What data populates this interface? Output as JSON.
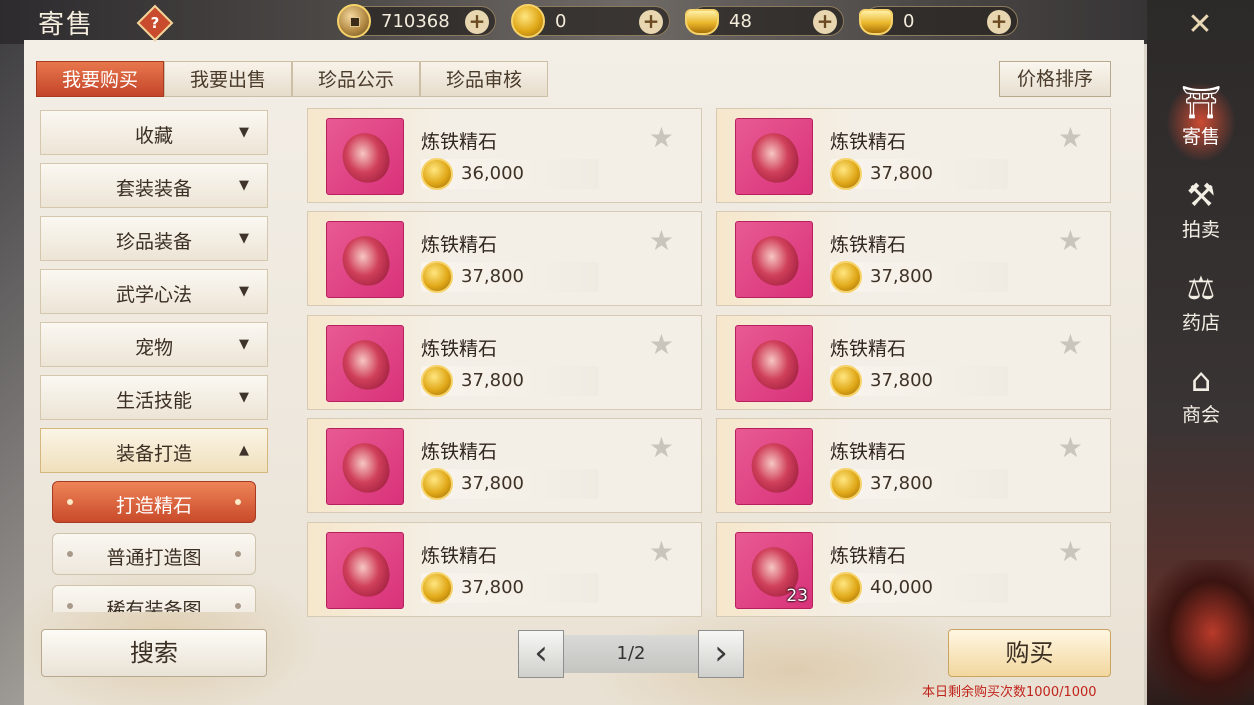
{
  "header": {
    "title": "寄售",
    "help_icon": "question-mark-icon",
    "currencies": [
      {
        "icon": "copper-coin-icon",
        "value": "710368"
      },
      {
        "icon": "gold-coin-icon",
        "value": "0"
      },
      {
        "icon": "bound-ingot-icon",
        "value": "48"
      },
      {
        "icon": "gold-ingot-icon",
        "value": "0"
      }
    ],
    "plus_symbol": "+",
    "close_symbol": "✕"
  },
  "tabs": [
    {
      "label": "我要购买",
      "active": true
    },
    {
      "label": "我要出售",
      "active": false
    },
    {
      "label": "珍品公示",
      "active": false
    },
    {
      "label": "珍品审核",
      "active": false
    }
  ],
  "sort_button": "价格排序",
  "categories": [
    {
      "label": "收藏",
      "arrow": "▼"
    },
    {
      "label": "套装装备",
      "arrow": "▼"
    },
    {
      "label": "珍品装备",
      "arrow": "▼"
    },
    {
      "label": "武学心法",
      "arrow": "▼"
    },
    {
      "label": "宠物",
      "arrow": "▼"
    },
    {
      "label": "生活技能",
      "arrow": "▼"
    },
    {
      "label": "装备打造",
      "arrow": "▲"
    }
  ],
  "subcategories": [
    {
      "label": "打造精石",
      "active": true
    },
    {
      "label": "普通打造图",
      "active": false
    },
    {
      "label": "稀有装备图",
      "active": false
    }
  ],
  "search_button": "搜索",
  "items": [
    {
      "name": "炼铁精石",
      "price": "36,000",
      "qty": ""
    },
    {
      "name": "炼铁精石",
      "price": "37,800",
      "qty": ""
    },
    {
      "name": "炼铁精石",
      "price": "37,800",
      "qty": ""
    },
    {
      "name": "炼铁精石",
      "price": "37,800",
      "qty": ""
    },
    {
      "name": "炼铁精石",
      "price": "37,800",
      "qty": ""
    },
    {
      "name": "炼铁精石",
      "price": "37,800",
      "qty": ""
    },
    {
      "name": "炼铁精石",
      "price": "37,800",
      "qty": ""
    },
    {
      "name": "炼铁精石",
      "price": "37,800",
      "qty": ""
    },
    {
      "name": "炼铁精石",
      "price": "37,800",
      "qty": ""
    },
    {
      "name": "炼铁精石",
      "price": "40,000",
      "qty": "23"
    }
  ],
  "star_symbol": "★",
  "pagination": {
    "prev": "‹",
    "next": "›",
    "page": "1/2"
  },
  "buy_button": "购买",
  "remaining_text": "本日剩余购买次数1000/1000",
  "right_nav": [
    {
      "label": "寄售",
      "icon": "pavilion-icon",
      "glyph": "⛩",
      "active": true
    },
    {
      "label": "拍卖",
      "icon": "gavel-icon",
      "glyph": "⚒",
      "active": false
    },
    {
      "label": "药店",
      "icon": "scales-icon",
      "glyph": "⚖",
      "active": false
    },
    {
      "label": "商会",
      "icon": "shop-icon",
      "glyph": "⌂",
      "active": false
    }
  ],
  "colors": {
    "accent": "#c94a2a",
    "remaining_text": "#c0231b",
    "item_bg": "#e0457f"
  }
}
